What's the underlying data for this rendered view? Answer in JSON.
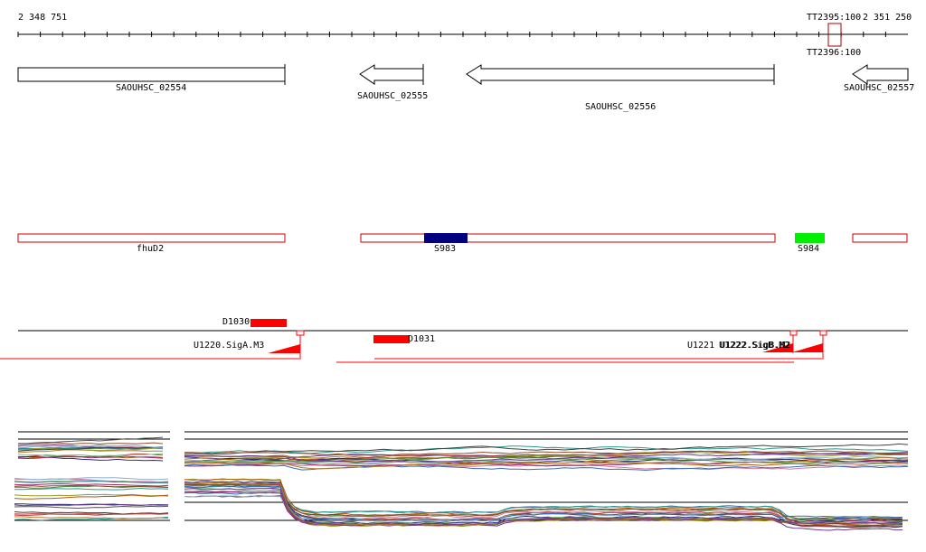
{
  "ruler": {
    "start_label": "2 348 751",
    "end_label": "2 351 250",
    "terminator_top_label": "TT2395:100",
    "terminator_bottom_label": "TT2396:100"
  },
  "genes": [
    {
      "label": "SAOUHSC_02554",
      "strand": "+"
    },
    {
      "label": "SAOUHSC_02555",
      "strand": "-"
    },
    {
      "label": "SAOUHSC_02556",
      "strand": "-"
    },
    {
      "label": "SAOUHSC_02557",
      "strand": "-"
    }
  ],
  "features": [
    {
      "label": "fhuD2"
    },
    {
      "label": "S983"
    },
    {
      "label": "S984"
    }
  ],
  "feature_colors": {
    "outline": "#cc0000",
    "s983": "#000080",
    "s984": "#00ee00"
  },
  "promoter_track": {
    "d1030_label": "D1030",
    "d1031_label": "D1031",
    "sig_a_label": "U1220.SigA.M3",
    "sig_b_overlap_label": "U1221 U1222.SigB.M2",
    "sig_b_label": "U1222.SigB.M2",
    "color": "#ff0000"
  }
}
